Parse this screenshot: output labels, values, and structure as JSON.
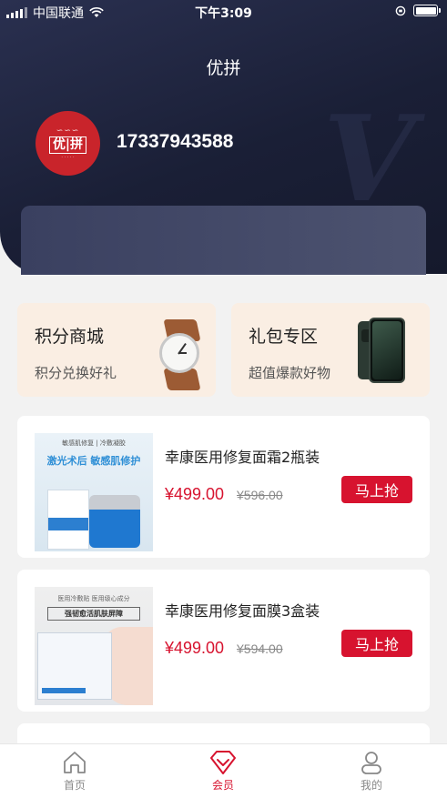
{
  "status_bar": {
    "carrier": "中国联通",
    "time": "下午3:09"
  },
  "header": {
    "title": "优拼"
  },
  "profile": {
    "phone": "17337943588",
    "avatar": {
      "brand": "优|拼",
      "brand_color": "#c9242b"
    }
  },
  "promos": [
    {
      "title": "积分商城",
      "subtitle": "积分兑换好礼",
      "icon": "watch-icon"
    },
    {
      "title": "礼包专区",
      "subtitle": "超值爆款好物",
      "icon": "phone-icon"
    }
  ],
  "products": [
    {
      "name": "幸康医用修复面霜2瓶装",
      "price": "¥499.00",
      "original_price": "¥596.00",
      "button": "马上抢",
      "thumb": {
        "line1": "敏感肌修复 | 冷敷凝胶",
        "line2": "激光术后 敏感肌修护"
      }
    },
    {
      "name": "幸康医用修复面膜3盒装",
      "price": "¥499.00",
      "original_price": "¥594.00",
      "button": "马上抢",
      "thumb": {
        "line1": "医用冷敷贴 医用级心成分",
        "line2": "强韧愈活肌肤屏障"
      }
    }
  ],
  "tabbar": [
    {
      "label": "首页",
      "icon": "home-icon",
      "active": false
    },
    {
      "label": "会员",
      "icon": "diamond-icon",
      "active": true
    },
    {
      "label": "我的",
      "icon": "user-icon",
      "active": false
    }
  ],
  "colors": {
    "accent": "#d7132f",
    "header_bg": "#1a1f36",
    "promo_bg": "#faeee3"
  }
}
